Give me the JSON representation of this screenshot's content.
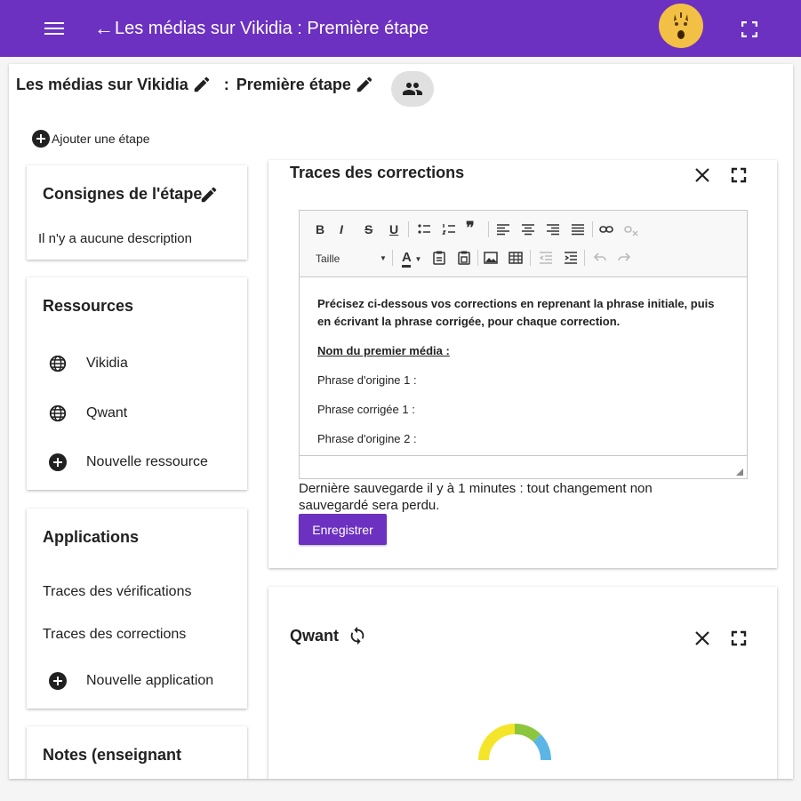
{
  "header": {
    "title": "Les médias sur Vikidia  :  Première étape",
    "back_glyph": "←"
  },
  "page": {
    "title_part1": "Les médias sur Vikidia",
    "separator": ":",
    "title_part2": "Première étape",
    "add_step_label": "Ajouter une étape"
  },
  "sidebar": {
    "consignes": {
      "title": "Consignes de l'étape",
      "description": "Il n'y a aucune description"
    },
    "ressources": {
      "title": "Ressources",
      "items": [
        {
          "label": "Vikidia",
          "icon": "globe-icon"
        },
        {
          "label": "Qwant",
          "icon": "globe-icon"
        }
      ],
      "add_label": "Nouvelle ressource"
    },
    "applications": {
      "title": "Applications",
      "items": [
        {
          "label": "Traces des vérifications"
        },
        {
          "label": "Traces des corrections"
        }
      ],
      "add_label": "Nouvelle application"
    },
    "notes": {
      "title": "Notes (enseignant"
    }
  },
  "corrections_panel": {
    "title": "Traces des corrections",
    "toolbar": {
      "size_label": "Taille",
      "bold": "B",
      "italic": "I",
      "strike": "S",
      "underline": "U",
      "quote": "❞",
      "font_color": "A"
    },
    "content": {
      "intro": "Précisez ci-dessous vos corrections en reprenant la phrase initiale, puis en écrivant la phrase corrigée, pour chaque correction.",
      "heading": "Nom du premier média :",
      "lines": [
        "Phrase d'origine 1 :",
        "Phrase corrigée 1 :",
        "Phrase d'origine 2 :"
      ]
    },
    "save_status": "Dernière sauvegarde il y à 1 minutes : tout changement non sauvegardé sera perdu.",
    "save_button": "Enregistrer"
  },
  "qwant_panel": {
    "title": "Qwant"
  },
  "colors": {
    "primary": "#6c31c0",
    "avatar": "#f2c045"
  }
}
